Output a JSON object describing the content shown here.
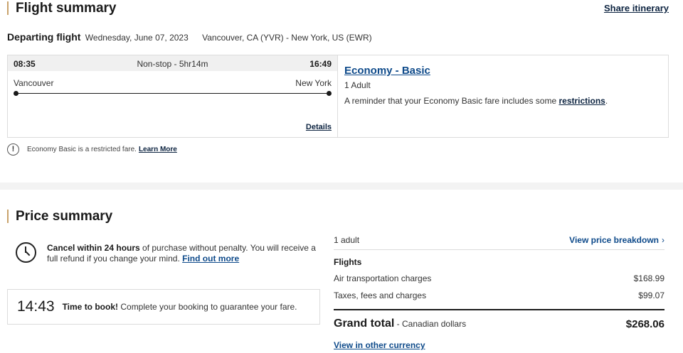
{
  "flight_summary": {
    "title": "Flight summary",
    "share_label": "Share itinerary",
    "departing_label": "Departing flight",
    "date": "Wednesday, June 07, 2023",
    "route": "Vancouver, CA (YVR) - New York, US (EWR)",
    "departure_time": "08:35",
    "duration": "Non-stop - 5hr14m",
    "arrival_time": "16:49",
    "origin_city": "Vancouver",
    "destination_city": "New York",
    "details_label": "Details",
    "fare_name": "Economy - Basic",
    "passengers": "1 Adult",
    "fare_note_prefix": "A reminder that your Economy Basic fare includes some ",
    "fare_note_link": "restrictions",
    "fare_note_suffix": ".",
    "restriction_text": "Economy Basic is a restricted fare.",
    "learn_more_label": "Learn More",
    "warning_icon": "exclamation-icon"
  },
  "price_summary": {
    "title": "Price summary",
    "cancel_bold": "Cancel within 24 hours",
    "cancel_text": " of purchase without penalty. You will receive a full refund if you change your mind.",
    "find_out_more": "Find out more",
    "clock_icon": "clock-icon",
    "timer": "14:43",
    "timer_bold": "Time to book!",
    "timer_text": " Complete your booking to guarantee your fare.",
    "adult_label": "1 adult",
    "breakdown_label": "View price breakdown",
    "flights_heading": "Flights",
    "charges": [
      {
        "label": "Air transportation charges",
        "value": "$168.99"
      },
      {
        "label": "Taxes, fees and charges",
        "value": "$99.07"
      }
    ],
    "grand_total_label": "Grand total",
    "grand_total_currency": " - Canadian dollars",
    "grand_total_value": "$268.06",
    "other_currency_label": "View in other currency"
  },
  "colors": {
    "accent_bar": "#c9a36b",
    "link_navy": "#0c2340",
    "link_blue": "#0e4a8a",
    "divider_band": "#f3f3f3"
  }
}
